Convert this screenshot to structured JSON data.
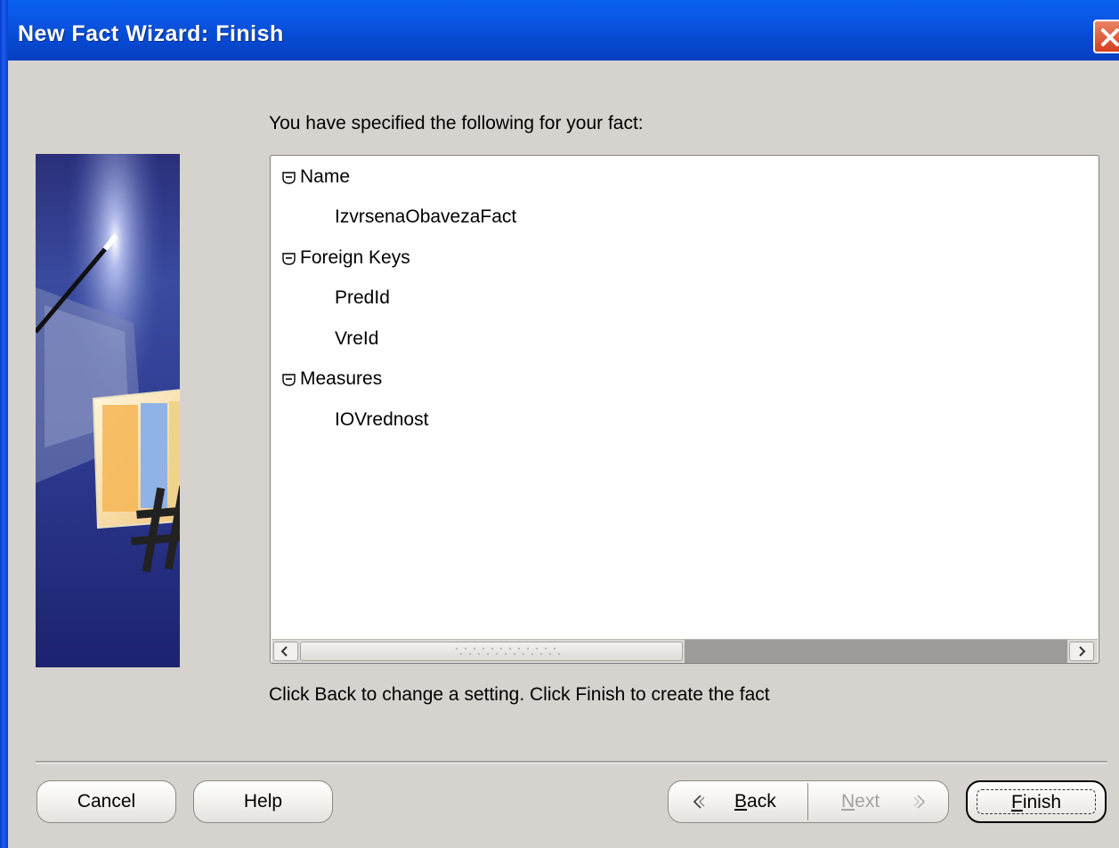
{
  "window": {
    "title": "New Fact Wizard: Finish"
  },
  "intro_text": "You have specified the following for your fact:",
  "tree": {
    "name_group": {
      "label": "Name",
      "items": [
        "IzvrsenaObavezaFact"
      ]
    },
    "fk_group": {
      "label": "Foreign Keys",
      "items": [
        "PredId",
        "VreId"
      ]
    },
    "measures_group": {
      "label": "Measures",
      "items": [
        "IOVrednost"
      ]
    }
  },
  "hint_text": "Click Back to change a setting. Click Finish to create the fact",
  "buttons": {
    "cancel": "Cancel",
    "help": "Help",
    "back_mnemonic": "B",
    "back_rest": "ack",
    "next_mnemonic": "N",
    "next_rest": "ext",
    "finish_mnemonic": "F",
    "finish_rest": "inish"
  },
  "colors": {
    "title_bar": "#0a53e0",
    "dialog_bg": "#d6d3ce",
    "close_button": "#d6401f"
  }
}
